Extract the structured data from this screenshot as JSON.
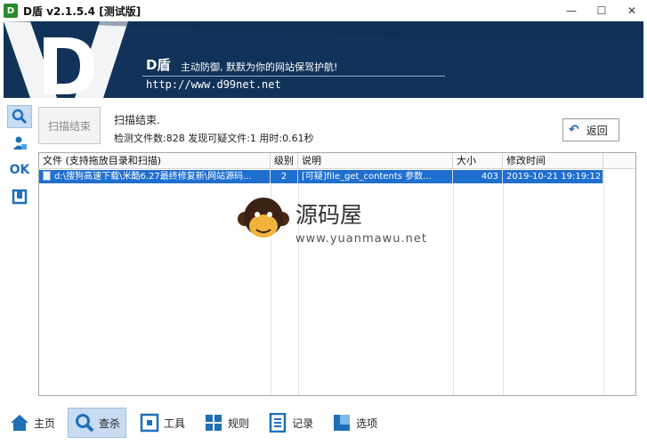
{
  "window": {
    "app_icon_text": "D",
    "title": "D盾 v2.1.5.4 [测试版]",
    "minimize": "—",
    "maximize": "☐",
    "close": "✕"
  },
  "banner": {
    "brand": "D盾",
    "slogan": "主动防御, 默默为你的网站保驾护航!",
    "url": "http://www.d99net.net"
  },
  "left_toolbar": {
    "items": [
      {
        "icon": "search-icon",
        "active": true
      },
      {
        "icon": "user-scan-icon",
        "active": false
      },
      {
        "icon": "ok-icon",
        "label": "OK",
        "active": false
      },
      {
        "icon": "frame-icon",
        "active": false
      }
    ]
  },
  "scan": {
    "button_label": "扫描结束",
    "status": "扫描结束.",
    "stats": "检测文件数:828 发现可疑文件:1 用时:0.61秒",
    "back_label": "返回"
  },
  "table": {
    "columns": [
      "文件 (支持拖放目录和扫描)",
      "级别",
      "说明",
      "大小",
      "修改时间"
    ],
    "rows": [
      {
        "file": "d:\\搜狗高速下载\\米酷6.27最终修复新\\网站源码...",
        "level": "2",
        "description": "[可疑]file_get_contents 参数...",
        "size": "403",
        "modified": "2019-10-21 19:19:12",
        "selected": true
      }
    ]
  },
  "watermark": {
    "name": "源码屋",
    "url": "www.yuanmawu.net"
  },
  "bottom_nav": {
    "items": [
      {
        "label": "主页",
        "icon": "home-icon",
        "active": false
      },
      {
        "label": "查杀",
        "icon": "search-icon",
        "active": true
      },
      {
        "label": "工具",
        "icon": "tools-icon",
        "active": false
      },
      {
        "label": "规则",
        "icon": "rules-icon",
        "active": false
      },
      {
        "label": "记录",
        "icon": "log-icon",
        "active": false
      },
      {
        "label": "选项",
        "icon": "options-icon",
        "active": false
      }
    ]
  },
  "colors": {
    "banner_bg": "#11335a",
    "accent": "#1f6fd0",
    "active_bg": "#c7dcf1"
  }
}
